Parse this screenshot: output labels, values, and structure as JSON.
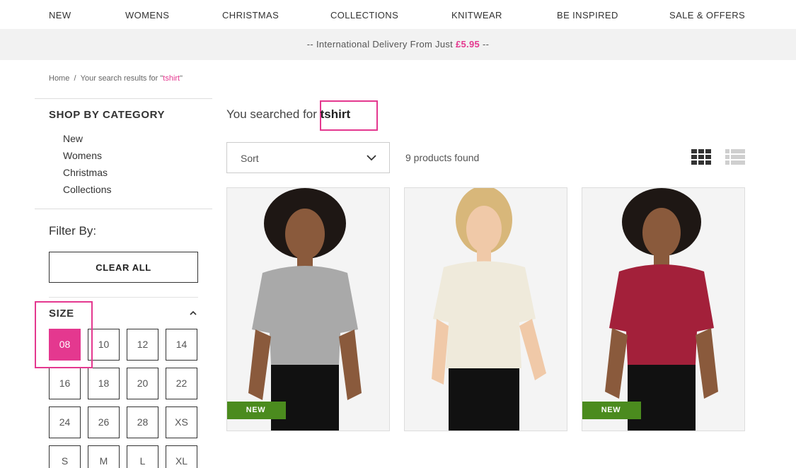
{
  "nav": {
    "items": [
      "NEW",
      "WOMENS",
      "CHRISTMAS",
      "COLLECTIONS",
      "KNITWEAR",
      "BE INSPIRED",
      "SALE & OFFERS"
    ]
  },
  "promo": {
    "prefix": "-- International Delivery From Just ",
    "price": "£5.95",
    "suffix": " --"
  },
  "breadcrumb": {
    "home": "Home",
    "separator": "/",
    "search_prefix": "Your search results for \"",
    "query": "tshirt",
    "search_suffix": "\""
  },
  "sidebar": {
    "shop_title": "SHOP BY CATEGORY",
    "categories": [
      "New",
      "Womens",
      "Christmas",
      "Collections"
    ],
    "filter_title": "Filter By:",
    "clear_all": "CLEAR ALL",
    "size_title": "SIZE",
    "sizes": [
      "08",
      "10",
      "12",
      "14",
      "16",
      "18",
      "20",
      "22",
      "24",
      "26",
      "28",
      "XS",
      "S",
      "M",
      "L",
      "XL"
    ],
    "selected_size": "08"
  },
  "results": {
    "heading_prefix": "You searched for ",
    "query": "tshirt",
    "sort_label": "Sort",
    "count_text": "9 products found"
  },
  "products": [
    {
      "badge": "NEW",
      "shirt_color": "#a9a9a9"
    },
    {
      "badge": "",
      "shirt_color": "#efeadb"
    },
    {
      "badge": "NEW",
      "shirt_color": "#a3203a"
    }
  ],
  "colors": {
    "accent": "#e4388f",
    "badge_green": "#4b8b1e"
  }
}
